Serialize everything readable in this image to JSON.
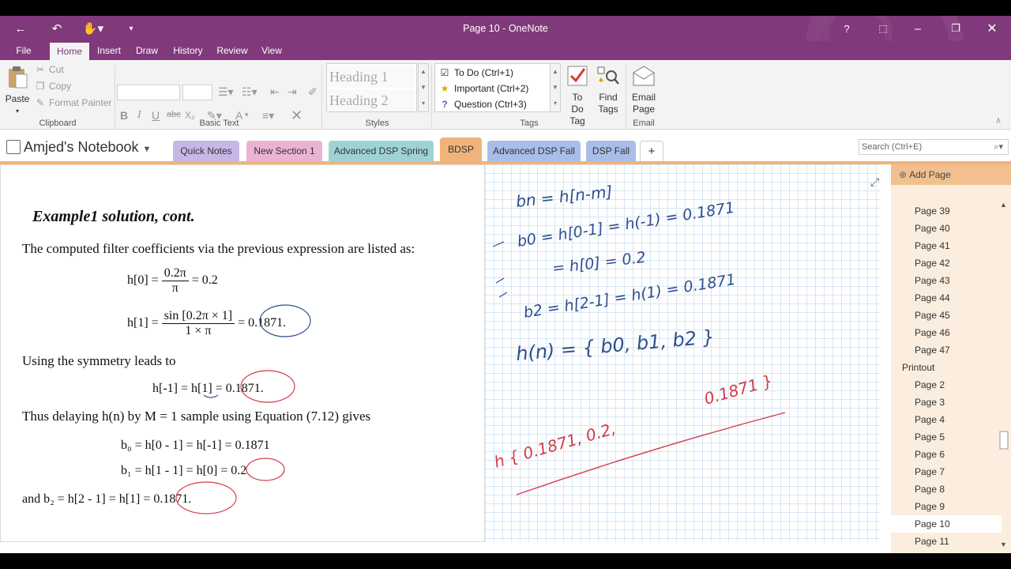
{
  "window": {
    "title": "Page 10 - OneNote",
    "help": "?"
  },
  "menu_tabs": [
    "File",
    "Home",
    "Insert",
    "Draw",
    "History",
    "Review",
    "View"
  ],
  "ribbon": {
    "clipboard": {
      "paste": "Paste",
      "cut": "Cut",
      "copy": "Copy",
      "format_painter": "Format Painter",
      "label": "Clipboard"
    },
    "basic_text": {
      "label": "Basic Text",
      "bold": "B",
      "italic": "I",
      "underline": "U",
      "strike": "abc",
      "subscript": "X₂",
      "font_color": "A"
    },
    "styles": {
      "heading1": "Heading 1",
      "heading2": "Heading 2",
      "label": "Styles"
    },
    "tags": {
      "todo": "To Do (Ctrl+1)",
      "important": "Important (Ctrl+2)",
      "question": "Question (Ctrl+3)",
      "todo_tag": "To Do Tag",
      "find_tags": "Find Tags",
      "label": "Tags"
    },
    "email": {
      "email_page": "Email Page",
      "label": "Email"
    }
  },
  "notebook": {
    "name": "Amjed's Notebook",
    "sections": [
      {
        "label": "Quick Notes",
        "color": "#c7b6e6"
      },
      {
        "label": "New Section 1",
        "color": "#ebb3d2"
      },
      {
        "label": "Advanced DSP Spring",
        "color": "#9ed3d6"
      },
      {
        "label": "BDSP",
        "color": "#f1b37a"
      },
      {
        "label": "Advanced DSP Fall",
        "color": "#a9bde9"
      },
      {
        "label": "DSP Fall",
        "color": "#a9bde9"
      },
      {
        "label": "+",
        "color": "#ffffff"
      }
    ],
    "search_placeholder": "Search (Ctrl+E)"
  },
  "slide": {
    "title": "Example1 solution, cont.",
    "line1": "The computed filter coefficients via the previous expression are listed as:",
    "eq_h0": {
      "lhs": "h[0] =",
      "num": "0.2π",
      "den": "π",
      "rhs": "= 0.2"
    },
    "eq_h1": {
      "lhs": "h[1] =",
      "num": "sin [0.2π × 1]",
      "den": "1 × π",
      "rhs": "= 0.1871."
    },
    "line2": "Using the symmetry leads to",
    "eq_hm1": "h[-1]   = h[1] = 0.1871.",
    "line3": "Thus delaying h(n) by M = 1 sample using Equation (7.12) gives",
    "eq_b0": "b₀ = h[0 - 1]  =   h[-1]   = 0.1871",
    "eq_b1": "b₁ = h[1 - 1]  = h[0] = 0.2",
    "eq_b2": "and b₂ =   h[2 - 1]  = h[1] = 0.1871."
  },
  "handwriting": {
    "lines": [
      "bn = h[n-m]",
      "b0 = h[0-1] = h(-1) = 0.1871",
      "= h[0] = 0.2",
      "b2 = h[2-1] = h(1) = 0.1871",
      "h(n) = { b0, b1, b2 }",
      "0.1871 }",
      "h { 0.1871, 0.2,"
    ]
  },
  "pages_panel": {
    "add_page": "Add Page",
    "items": [
      {
        "label": "Page 39",
        "indent": true
      },
      {
        "label": "Page 40",
        "indent": true
      },
      {
        "label": "Page 41",
        "indent": true
      },
      {
        "label": "Page 42",
        "indent": true
      },
      {
        "label": "Page 43",
        "indent": true
      },
      {
        "label": "Page 44",
        "indent": true
      },
      {
        "label": "Page 45",
        "indent": true
      },
      {
        "label": "Page 46",
        "indent": true
      },
      {
        "label": "Page 47",
        "indent": true
      },
      {
        "label": "Printout",
        "indent": false
      },
      {
        "label": "Page 2",
        "indent": true
      },
      {
        "label": "Page 3",
        "indent": true
      },
      {
        "label": "Page 4",
        "indent": true
      },
      {
        "label": "Page 5",
        "indent": true
      },
      {
        "label": "Page 6",
        "indent": true
      },
      {
        "label": "Page 7",
        "indent": true
      },
      {
        "label": "Page 8",
        "indent": true
      },
      {
        "label": "Page 9",
        "indent": true
      },
      {
        "label": "Page 10",
        "indent": true,
        "selected": true
      },
      {
        "label": "Page 11",
        "indent": true
      }
    ]
  },
  "colors": {
    "accent": "#80397b",
    "section_active": "#f1b37a",
    "ink_blue": "#2f4f8f",
    "ink_red": "#d23c4a"
  }
}
